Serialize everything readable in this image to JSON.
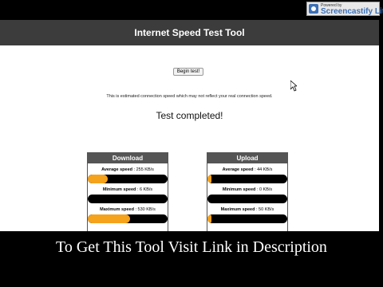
{
  "header": {
    "title": "Internet Speed Test Tool"
  },
  "watermark": {
    "small": "Powered by",
    "brand": "Screencastify Lite"
  },
  "controls": {
    "begin_label": "Begin test!"
  },
  "disclaimer": "This is estimated connection speed which may not reflect your real connection speed.",
  "status": "Test completed!",
  "download": {
    "title": "Download",
    "average": {
      "label": "Average speed",
      "value": ": 255 KB/s",
      "fill": 0.25
    },
    "minimum": {
      "label": "Minimum speed",
      "value": ": 6 KB/s",
      "fill": 0.0
    },
    "maximum": {
      "label": "Maximum speed",
      "value": ": 530 KB/s",
      "fill": 0.53
    }
  },
  "upload": {
    "title": "Upload",
    "average": {
      "label": "Average speed",
      "value": ": 44 KB/s",
      "fill": 0.05
    },
    "minimum": {
      "label": "Minimum speed",
      "value": ": 0 KB/s",
      "fill": 0.0
    },
    "maximum": {
      "label": "Maximum speed",
      "value": ": 50 KB/s",
      "fill": 0.05
    }
  },
  "caption": "To Get This Tool Visit Link in Description",
  "colors": {
    "accent": "#f5a21c",
    "header": "#3c3c3c",
    "panel_header": "#555555"
  }
}
